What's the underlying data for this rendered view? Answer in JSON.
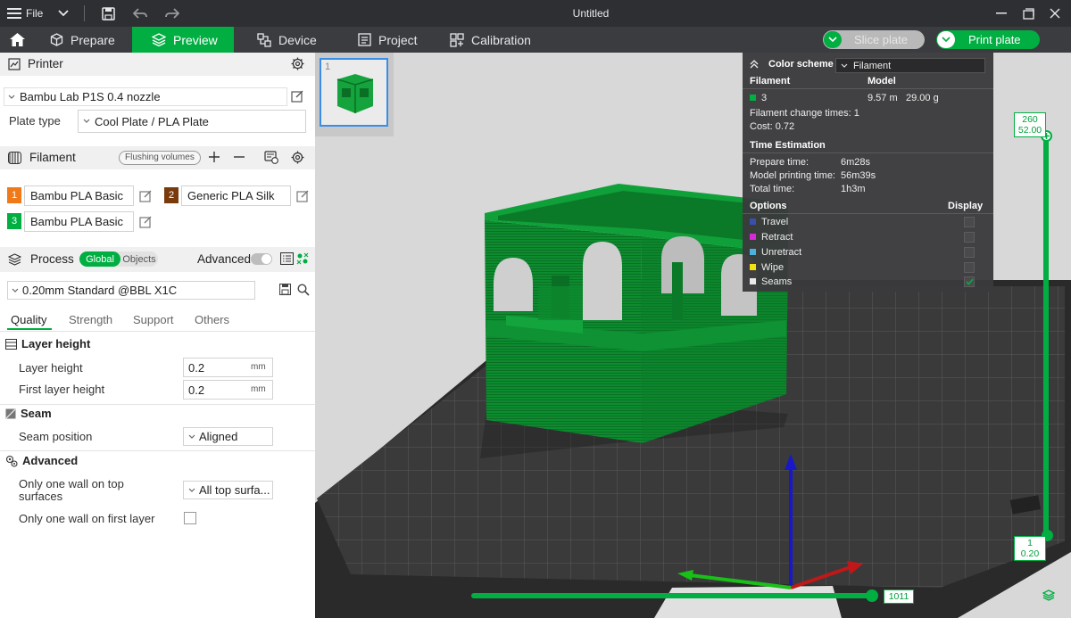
{
  "titlebar": {
    "file_label": "File",
    "title": "Untitled"
  },
  "nav": {
    "tabs": [
      {
        "label": "Prepare"
      },
      {
        "label": "Preview"
      },
      {
        "label": "Device"
      },
      {
        "label": "Project"
      },
      {
        "label": "Calibration"
      }
    ],
    "slice_label": "Slice plate",
    "print_label": "Print plate"
  },
  "printer": {
    "section_label": "Printer",
    "selected": "Bambu Lab P1S 0.4 nozzle",
    "plate_type_label": "Plate type",
    "plate_type_value": "Cool Plate / PLA Plate"
  },
  "filament": {
    "section_label": "Filament",
    "flushing_label": "Flushing volumes",
    "items": [
      {
        "num": "1",
        "name": "Bambu PLA Basic",
        "color": "#f07a1a"
      },
      {
        "num": "2",
        "name": "Generic PLA Silk",
        "color": "#7a3b0c"
      },
      {
        "num": "3",
        "name": "Bambu PLA Basic",
        "color": "#00ae42"
      }
    ]
  },
  "process": {
    "section_label": "Process",
    "global_label": "Global",
    "objects_label": "Objects",
    "advanced_label": "Advanced",
    "preset": "0.20mm Standard @BBL X1C",
    "tabs": [
      "Quality",
      "Strength",
      "Support",
      "Others"
    ]
  },
  "quality": {
    "layer_height_group": "Layer height",
    "layer_height_label": "Layer height",
    "layer_height_value": "0.2",
    "first_layer_label": "First layer height",
    "first_layer_value": "0.2",
    "unit": "mm",
    "seam_group": "Seam",
    "seam_position_label": "Seam position",
    "seam_position_value": "Aligned",
    "advanced_group": "Advanced",
    "top_wall_label_1": "Only one wall on top",
    "top_wall_label_2": "surfaces",
    "top_wall_value": "All top surfa...",
    "first_wall_label": "Only one wall on first layer"
  },
  "legend": {
    "color_scheme_label": "Color scheme",
    "color_scheme_value": "Filament",
    "filament_header": "Filament",
    "model_header": "Model",
    "filament_row": {
      "num": "3",
      "length": "9.57 m",
      "weight": "29.00 g",
      "color": "#00ae42"
    },
    "change_times": "Filament change times:  1",
    "cost": "Cost:  0.72",
    "time_header": "Time Estimation",
    "prepare_time_label": "Prepare time:",
    "prepare_time": "6m28s",
    "model_time_label": "Model printing time:",
    "model_time": "56m39s",
    "total_time_label": "Total time:",
    "total_time": "1h3m",
    "options_header": "Options",
    "display_header": "Display",
    "options": [
      {
        "label": "Travel",
        "color": "#3a4fa8",
        "checked": false
      },
      {
        "label": "Retract",
        "color": "#d52ad5",
        "checked": false
      },
      {
        "label": "Unretract",
        "color": "#4bb0dc",
        "checked": false
      },
      {
        "label": "Wipe",
        "color": "#f2e010",
        "checked": false
      },
      {
        "label": "Seams",
        "color": "#e8e8e8",
        "checked": true
      }
    ]
  },
  "sliders": {
    "top_layer": "260",
    "top_height": "52.00",
    "bottom_layer": "1",
    "bottom_height": "0.20",
    "move_value": "1011"
  },
  "plate": {
    "number": "1"
  }
}
